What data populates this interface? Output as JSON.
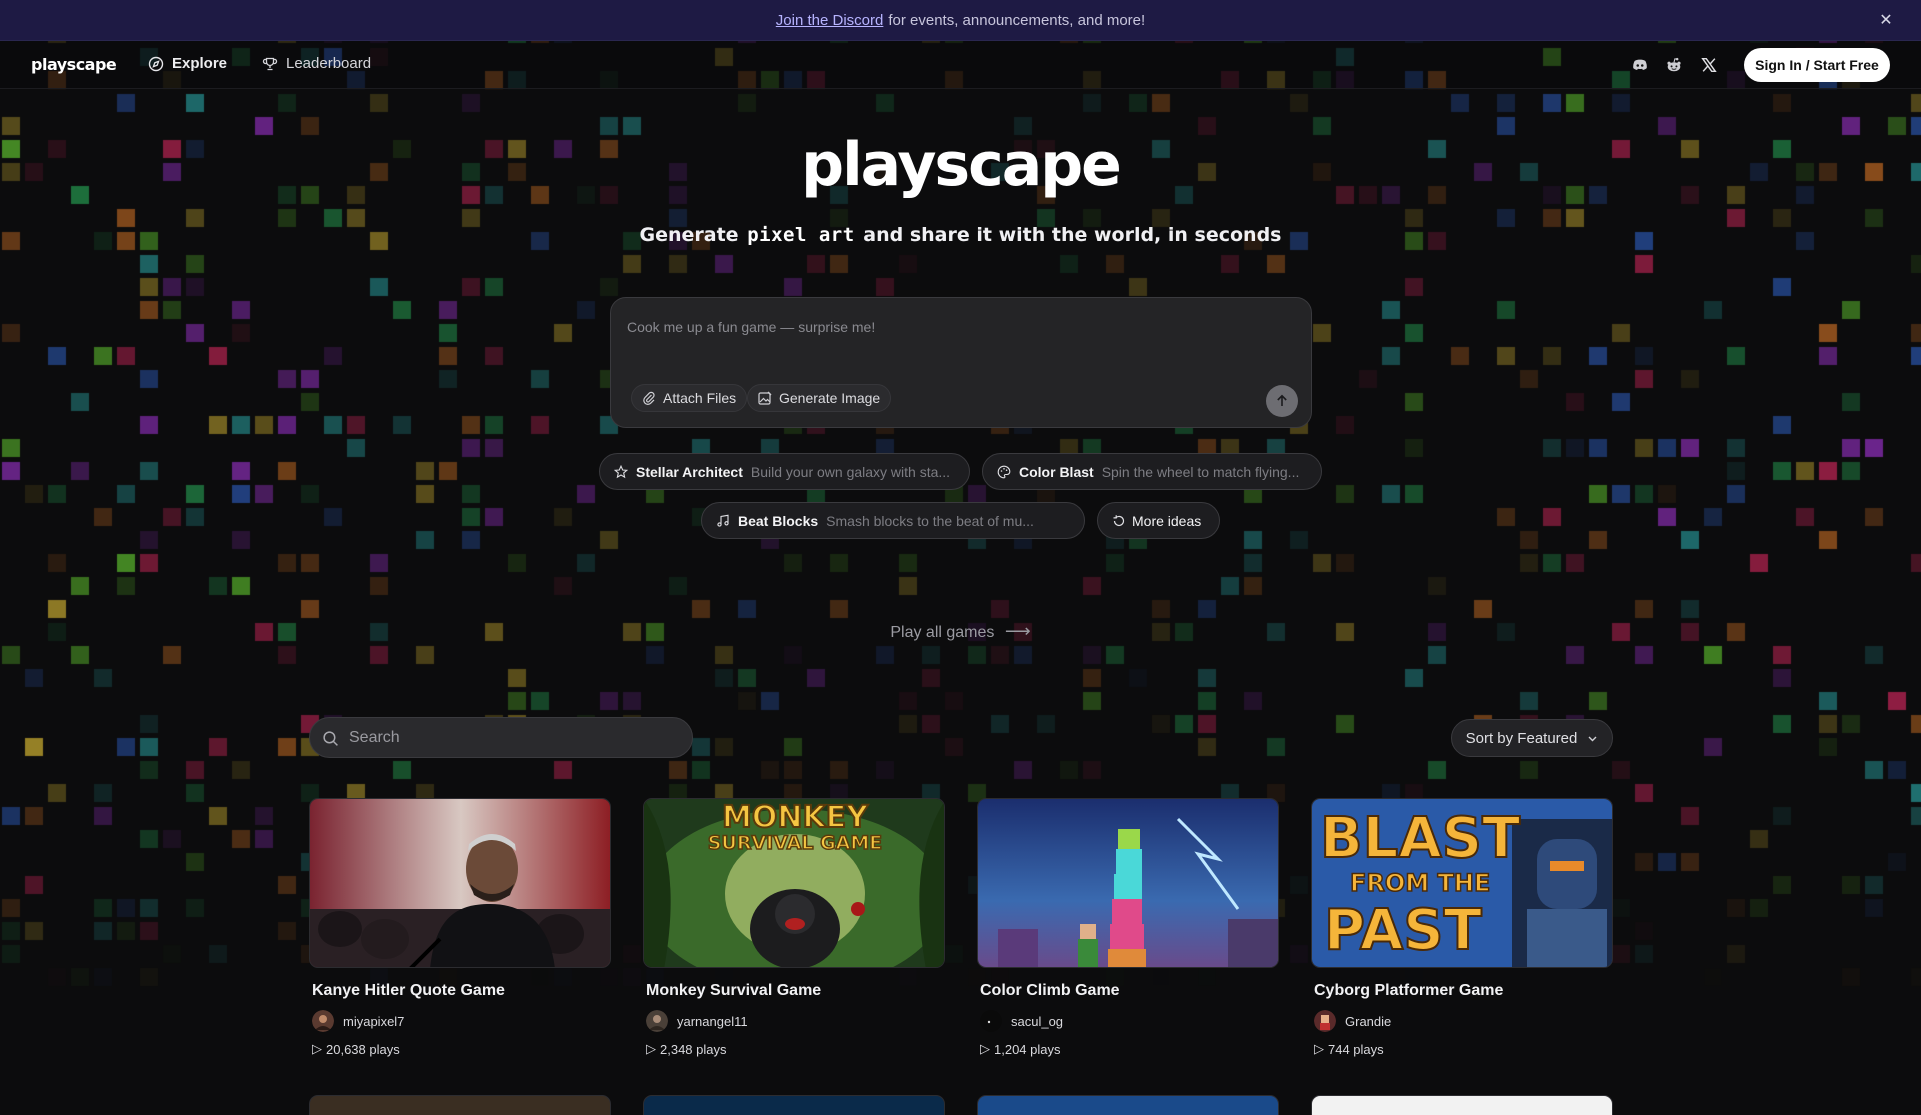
{
  "banner": {
    "link_text": "Join the Discord",
    "message": "for events, announcements, and more!",
    "close_icon": "close-icon"
  },
  "nav": {
    "logo": "playscape",
    "links": [
      {
        "label": "Explore",
        "icon": "compass-icon"
      },
      {
        "label": "Leaderboard",
        "icon": "trophy-icon"
      }
    ],
    "social": [
      "discord-icon",
      "reddit-icon",
      "x-icon"
    ],
    "signin_label": "Sign In / Start Free"
  },
  "hero": {
    "title": "playscape",
    "subtitle_before": "Generate",
    "subtitle_highlight": "pixel art",
    "subtitle_after": "and share it with the world, in seconds"
  },
  "prompt": {
    "placeholder": "Cook me up a fun game — surprise me!",
    "attach_label": "Attach Files",
    "generate_image_label": "Generate Image",
    "send_icon": "arrow-up-icon"
  },
  "suggestions": [
    {
      "title": "Stellar Architect",
      "desc": "Build your own galaxy with sta...",
      "icon": "star-icon"
    },
    {
      "title": "Color Blast",
      "desc": "Spin the wheel to match flying...",
      "icon": "palette-icon"
    },
    {
      "title": "Beat Blocks",
      "desc": "Smash blocks to the beat of mu...",
      "icon": "music-icon"
    }
  ],
  "more_ideas_label": "More ideas",
  "play_all_label": "Play all games",
  "search": {
    "placeholder": "Search"
  },
  "sort": {
    "label": "Sort by Featured"
  },
  "games": [
    {
      "title": "Kanye Hitler Quote Game",
      "author": "miyapixel7",
      "plays": "20,638 plays"
    },
    {
      "title": "Monkey Survival Game",
      "author": "yarnangel11",
      "plays": "2,348 plays",
      "thumb_text": [
        "MONKEY",
        "SURVIVAL GAME"
      ]
    },
    {
      "title": "Color Climb Game",
      "author": "sacul_og",
      "plays": "1,204 plays"
    },
    {
      "title": "Cyborg Platformer Game",
      "author": "Grandie",
      "plays": "744 plays",
      "thumb_text": [
        "BLAST",
        "FROM THE",
        "PAST"
      ]
    }
  ],
  "colors": {
    "banner_bg": "#1e1a44",
    "page_bg": "#0c0c0d",
    "accent_link": "#b7b4ff"
  }
}
